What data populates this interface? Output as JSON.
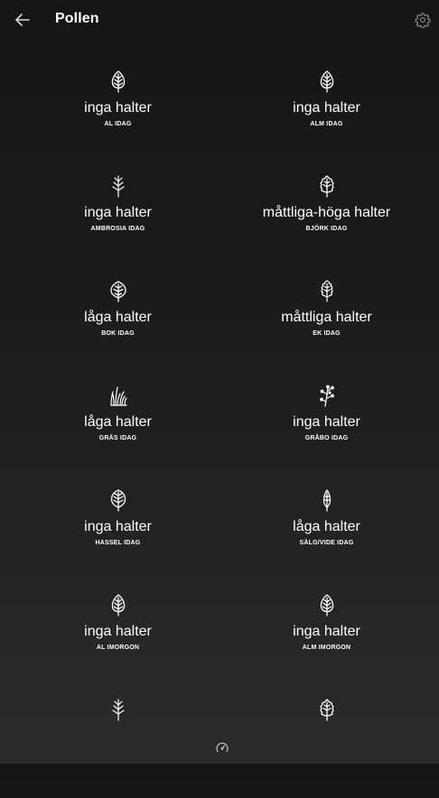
{
  "header": {
    "title": "Pollen",
    "back_icon": "arrow-left-icon",
    "settings_icon": "gear-icon"
  },
  "tiles": [
    {
      "level": "inga halter",
      "name": "AL IDAG",
      "icon": "leaf-icon"
    },
    {
      "level": "inga halter",
      "name": "ALM IDAG",
      "icon": "leaf-icon"
    },
    {
      "level": "inga halter",
      "name": "AMBROSIA IDAG",
      "icon": "ambrosia-icon"
    },
    {
      "level": "måttliga-höga halter",
      "name": "BJÖRK IDAG",
      "icon": "birch-leaf-icon"
    },
    {
      "level": "låga halter",
      "name": "BOK IDAG",
      "icon": "round-leaf-icon"
    },
    {
      "level": "måttliga halter",
      "name": "EK IDAG",
      "icon": "oak-leaf-icon"
    },
    {
      "level": "låga halter",
      "name": "GRÄS IDAG",
      "icon": "grass-icon"
    },
    {
      "level": "inga halter",
      "name": "GRÅBO IDAG",
      "icon": "mugwort-icon"
    },
    {
      "level": "inga halter",
      "name": "HASSEL IDAG",
      "icon": "hazel-leaf-icon"
    },
    {
      "level": "låga halter",
      "name": "SÄLG/VIDE IDAG",
      "icon": "willow-leaf-icon"
    },
    {
      "level": "inga halter",
      "name": "AL IMORGON",
      "icon": "leaf-icon"
    },
    {
      "level": "inga halter",
      "name": "ALM IMORGON",
      "icon": "leaf-icon"
    },
    {
      "level": "",
      "name": "",
      "icon": "ambrosia-icon"
    },
    {
      "level": "",
      "name": "",
      "icon": "birch-leaf-icon"
    }
  ],
  "footer": {
    "icon": "speedometer-icon"
  }
}
